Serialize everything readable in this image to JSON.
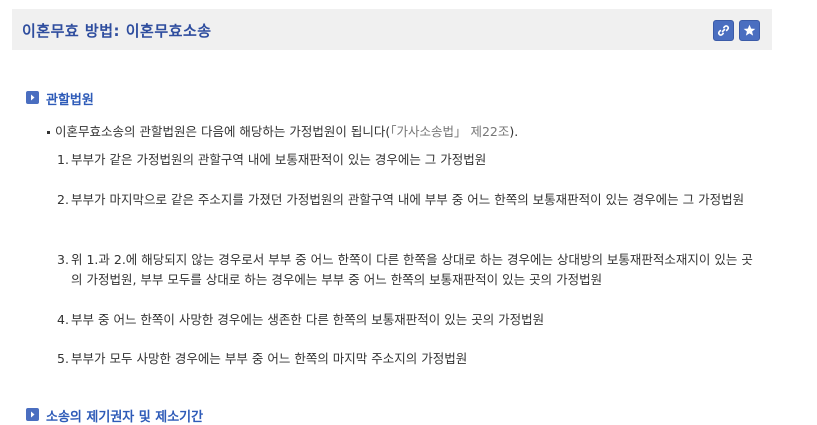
{
  "header": {
    "title": "이혼무효 방법: 이혼무효소송",
    "link_button_icon": "link-icon",
    "bookmark_button_icon": "star-icon"
  },
  "section1": {
    "title": "관할법원",
    "intro_prefix": "이혼무효소송의 관할법원은 다음에 해당하는 가정법원이 됩니다(",
    "intro_law": "「가사소송법」 제22조",
    "intro_suffix": ").",
    "items": [
      {
        "num": "1.",
        "text": "부부가 같은 가정법원의 관할구역 내에 보통재판적이 있는 경우에는 그 가정법원"
      },
      {
        "num": "2.",
        "text": "부부가 마지막으로 같은 주소지를 가졌던 가정법원의 관할구역 내에 부부 중 어느 한쪽의 보통재판적이 있는 경우에는 그 가정법원"
      },
      {
        "num": "3.",
        "text": "위 1.과 2.에 해당되지 않는 경우로서 부부 중 어느 한쪽이 다른 한쪽을 상대로 하는 경우에는 상대방의 보통재판적소재지이 있는 곳의 가정법원, 부부 모두를 상대로 하는 경우에는 부부 중 어느 한쪽의 보통재판적이 있는 곳의 가정법원"
      },
      {
        "num": "4.",
        "text": "부부 중 어느 한쪽이 사망한 경우에는 생존한 다른 한쪽의 보통재판적이 있는 곳의 가정법원"
      },
      {
        "num": "5.",
        "text": "부부가 모두 사망한 경우에는 부부 중 어느 한쪽의 마지막 주소지의 가정법원"
      }
    ]
  },
  "section2": {
    "title": "소송의 제기권자 및 제소기간"
  },
  "colors": {
    "title": "#2e4d9e",
    "section_title": "#2e5bb8",
    "button_bg": "#4a6ec0",
    "title_bar_bg": "#f0f0f0"
  }
}
